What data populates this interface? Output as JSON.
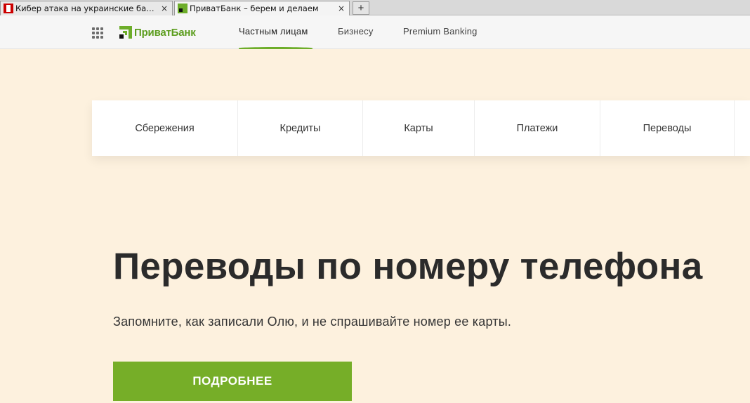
{
  "browser": {
    "tabs": [
      {
        "title": "Кибер атака на украинские банки. - Я...",
        "close": "×"
      },
      {
        "title": "ПриватБанк – берем и делаем",
        "close": "×"
      }
    ],
    "new_tab": "+"
  },
  "header": {
    "logo_text": "ПриватБанк",
    "nav": [
      {
        "label": "Частным лицам",
        "active": true
      },
      {
        "label": "Бизнесу"
      },
      {
        "label": "Premium Banking"
      }
    ]
  },
  "menu": {
    "items": [
      "Сбережения",
      "Кредиты",
      "Карты",
      "Платежи",
      "Переводы",
      ""
    ]
  },
  "hero": {
    "title": "Переводы по номеру телефона",
    "subtitle": "Запомните, как записали Олю, и не спрашивайте номер ее карты.",
    "button": "ПОДРОБНЕЕ"
  },
  "colors": {
    "brand_green": "#76ae28",
    "background": "#fdf1de"
  }
}
